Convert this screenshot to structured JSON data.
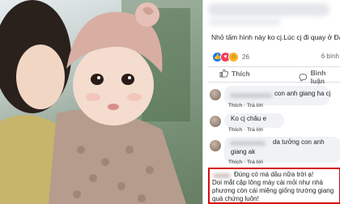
{
  "post": {
    "caption": "Nhỏ tấm hình này ko cj.Lúc cj đi quay ở Đà Lạt c",
    "reactions": {
      "icons": [
        "like-icon",
        "love-icon",
        "haha-icon"
      ],
      "count": "26",
      "shares": "6 bình"
    },
    "actions": {
      "like_label": "Thích",
      "comment_label": "Bình luận"
    }
  },
  "comments": [
    {
      "text": "con anh giang ha cj",
      "meta": "Thích · Trả lời"
    },
    {
      "text": "Ko cj châu e",
      "meta": "Thích · Trả lời"
    },
    {
      "text_line1": "da tưởng con anh",
      "text_line2": "giang ak",
      "meta": "Thích · Trả lời"
    }
  ],
  "highlighted_comment": {
    "line1": "Đúng có má dầu nữa trời ạ!",
    "line2": "Doi mắt cặp lông mày cái mỏi như nhà",
    "line3": "phương còn cái miệng giống trường giang",
    "line4": "quá chứng luôn!"
  },
  "colors": {
    "highlight_border": "#d60d0d",
    "like_blue": "#1877f2",
    "bubble_bg": "#f0f2f5"
  }
}
